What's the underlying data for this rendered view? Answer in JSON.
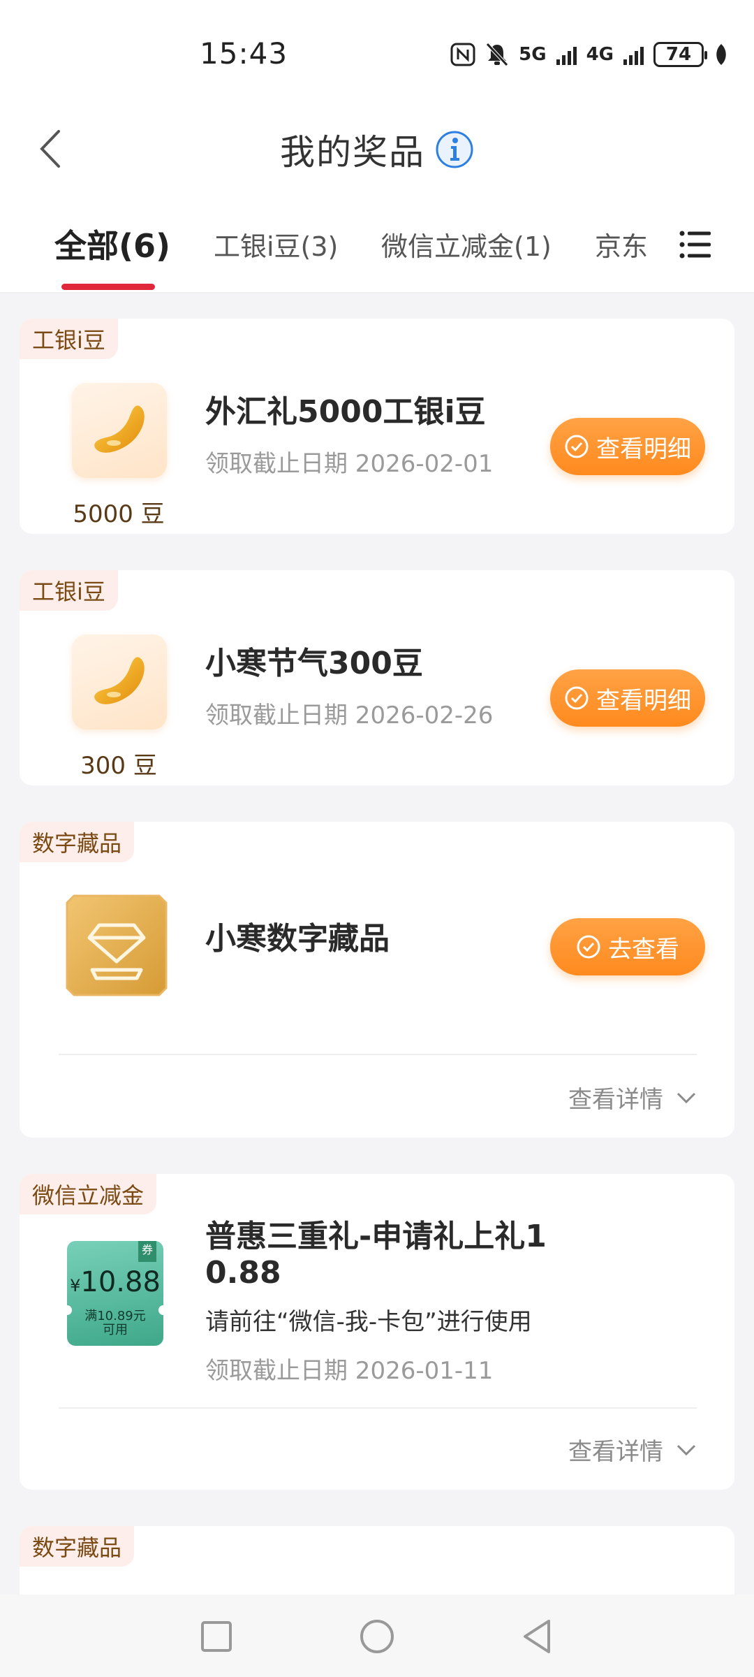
{
  "status_bar": {
    "time": "15:43",
    "signal_labels": [
      "5G",
      "4G"
    ],
    "battery": "74",
    "icons": [
      "nfc-icon",
      "mute-icon",
      "signal-5g-icon",
      "signal-4g-icon",
      "battery-icon",
      "leaf-icon"
    ]
  },
  "header": {
    "title": "我的奖品",
    "back_icon": "chevron-left-icon",
    "info_icon": "info-icon"
  },
  "tabs": [
    {
      "label": "全部(6)",
      "active": true
    },
    {
      "label": "工银i豆(3)",
      "active": false
    },
    {
      "label": "微信立减金(1)",
      "active": false
    },
    {
      "label": "京东",
      "active": false
    }
  ],
  "tab_menu_icon": "list-menu-icon",
  "accent_colors": {
    "tab_underline": "#e0283a",
    "action_button": "#ff8a1e",
    "tag_bg": "#fdeeec"
  },
  "cards": [
    {
      "tag": "工银i豆",
      "title": "外汇礼5000工银i豆",
      "deadline": "领取截止日期 2026-02-01",
      "thumb_caption": "5000 豆",
      "button": "查看明细"
    },
    {
      "tag": "工银i豆",
      "title": "小寒节气300豆",
      "deadline": "领取截止日期 2026-02-26",
      "thumb_caption": "300 豆",
      "button": "查看明细"
    },
    {
      "tag": "数字藏品",
      "title": "小寒数字藏品",
      "button": "去查看",
      "details": "查看详情"
    },
    {
      "tag": "微信立减金",
      "title_line1": "普惠三重礼-申请礼上礼1",
      "title_line2": "0.88",
      "note": "请前往“微信-我-卡包”进行使用",
      "deadline": "领取截止日期 2026-01-11",
      "details": "查看详情",
      "coupon": {
        "currency": "¥",
        "amount": "10.88",
        "condition_line1": "满10.89元",
        "condition_line2": "可用",
        "ribbon": "券"
      }
    },
    {
      "tag": "数字藏品"
    }
  ],
  "nav_bar": {
    "icons": [
      "recent-apps-icon",
      "home-icon",
      "back-icon"
    ]
  }
}
